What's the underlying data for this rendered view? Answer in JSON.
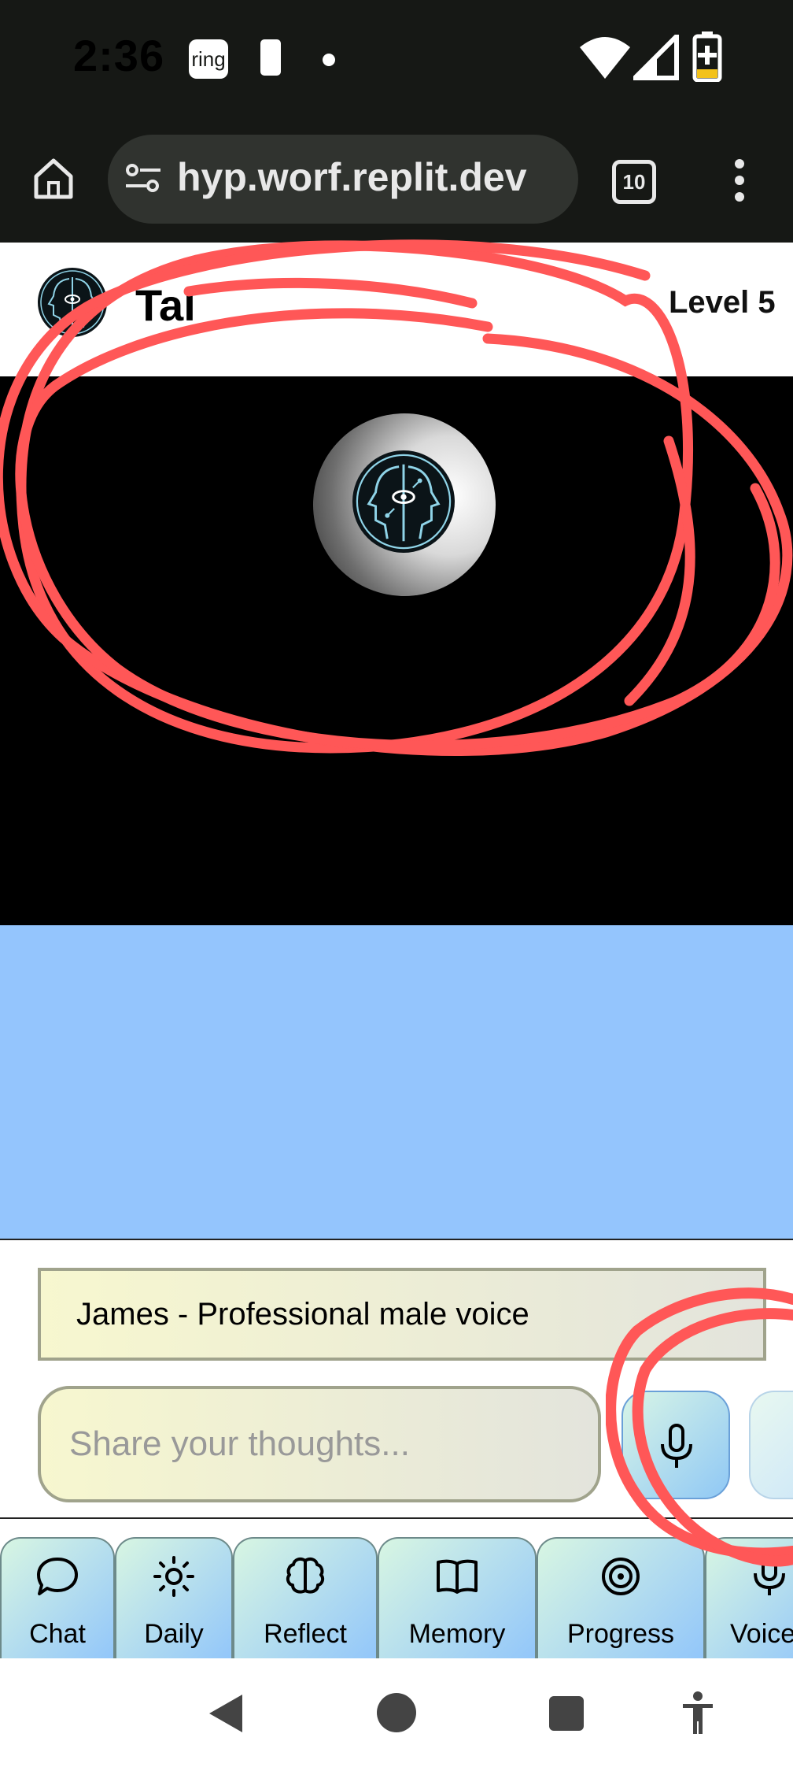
{
  "status_bar": {
    "time": "2:36",
    "ring_label": "ring"
  },
  "browser": {
    "url": "hyp.worf.replit.dev",
    "tab_count": "10"
  },
  "header": {
    "title": "Tal",
    "level": "Level 5"
  },
  "voice": {
    "selected": "James - Professional male voice"
  },
  "input": {
    "placeholder": "Share your thoughts..."
  },
  "nav": {
    "items": [
      {
        "label": "Chat",
        "icon": "chat-bubble-icon"
      },
      {
        "label": "Daily",
        "icon": "sun-icon"
      },
      {
        "label": "Reflect",
        "icon": "brain-icon"
      },
      {
        "label": "Memory",
        "icon": "book-icon"
      },
      {
        "label": "Progress",
        "icon": "target-icon"
      },
      {
        "label": "Voice",
        "icon": "mic-icon"
      }
    ]
  },
  "colors": {
    "accent_red": "#ff5757",
    "chat_bg": "#94c5fd",
    "video_bg": "#000000",
    "browser_bar": "#161815"
  }
}
